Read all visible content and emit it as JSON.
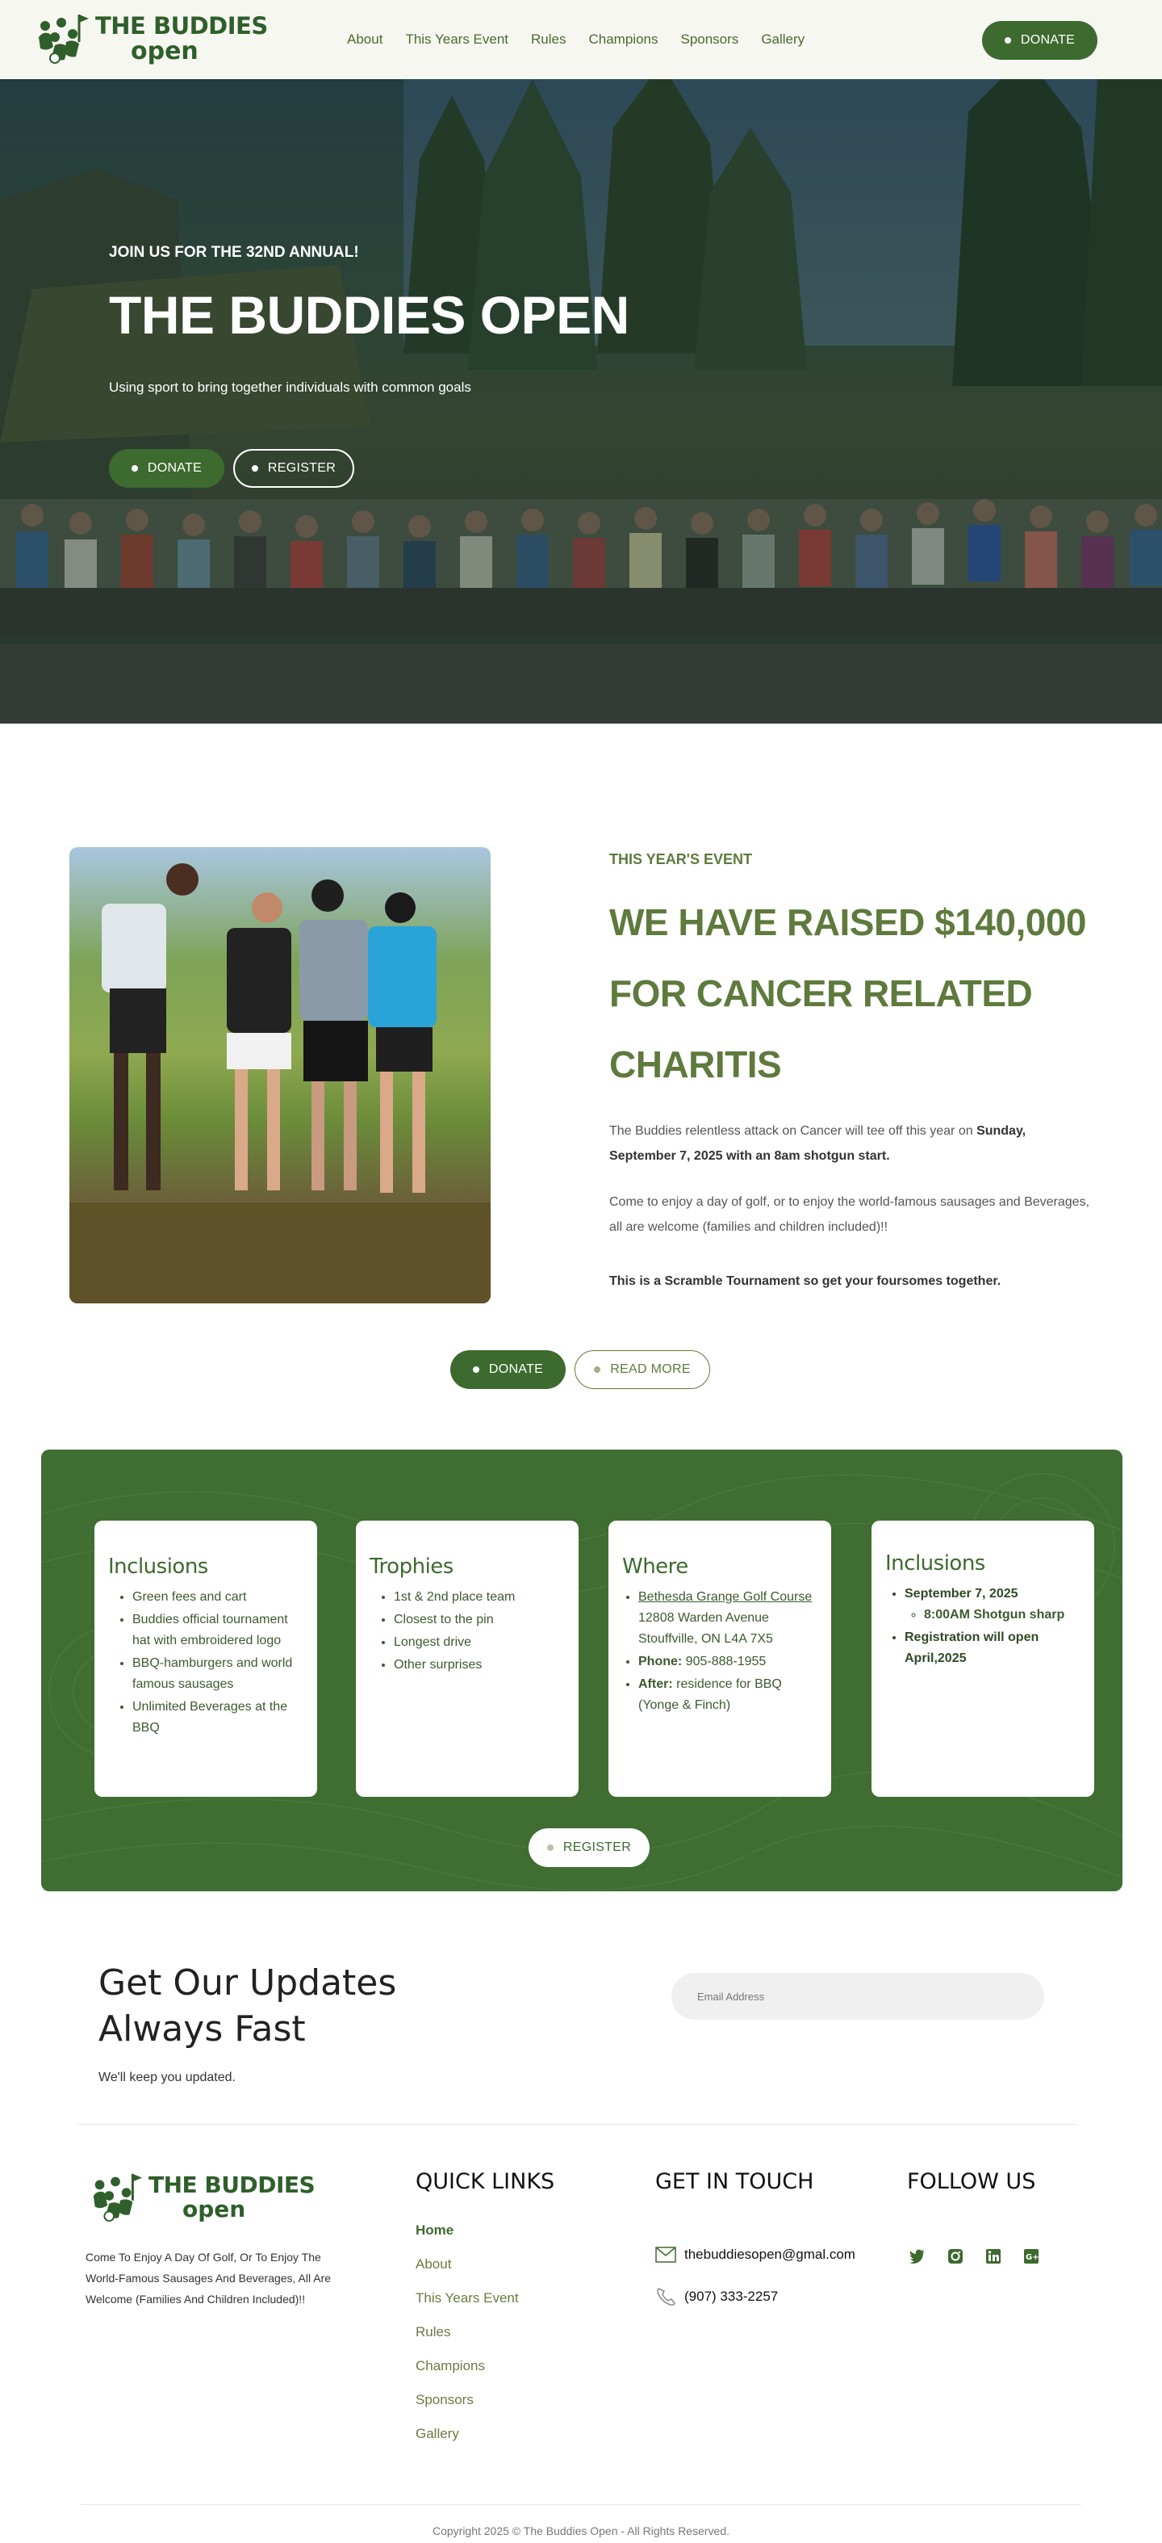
{
  "brand": {
    "line1": "THE BUDDIES",
    "line2": "open",
    "green": "#3d6a2f",
    "olive": "#5e7a3d"
  },
  "nav": {
    "items": [
      "About",
      "This Years Event",
      "Rules",
      "Champions",
      "Sponsors",
      "Gallery"
    ],
    "donate_label": "DONATE"
  },
  "hero": {
    "kicker": "JOIN US FOR THE 32ND ANNUAL!",
    "title": "THE BUDDIES OPEN",
    "subtitle": "Using sport to bring together individuals with common goals",
    "donate_label": "DONATE",
    "register_label": "REGISTER"
  },
  "event": {
    "kicker": "THIS YEAR'S EVENT",
    "title": "WE HAVE RAISED $140,000 FOR CANCER RELATED CHARITIS",
    "p1_text": "The Buddies relentless attack on Cancer will tee off this year on ",
    "p1_bold": "Sunday, September 7, 2025  with an 8am shotgun start.",
    "p2": "Come to enjoy a day of golf, or to enjoy the world-famous sausages and Beverages, all are welcome (families and children included)!!",
    "p3": "This is a Scramble Tournament so get your foursomes together.",
    "donate_label": "DONATE",
    "read_more_label": "READ MORE"
  },
  "cards": {
    "inclusions": {
      "title": "Inclusions",
      "items": [
        "Green fees and cart",
        "Buddies official tournament hat with embroidered logo",
        "BBQ-hamburgers and world famous sausages",
        "Unlimited Beverages at the BBQ"
      ]
    },
    "trophies": {
      "title": "Trophies",
      "items": [
        "1st & 2nd place team",
        "Closest to the pin",
        "Longest drive",
        "Other surprises"
      ]
    },
    "where": {
      "title": "Where",
      "venue": "Bethesda Grange Golf Course",
      "address1": "12808 Warden Avenue",
      "address2": "Stouffville, ON L4A 7X5",
      "phone_label": "Phone:",
      "phone": "905-888-1955",
      "after_label": "After:",
      "after": "residence for BBQ (Yonge & Finch)"
    },
    "dates": {
      "title": "Inclusions",
      "date": "September 7, 2025",
      "start": "8:00AM Shotgun sharp",
      "registration": "Registration will open April,2025"
    },
    "register_label": "REGISTER"
  },
  "updates": {
    "title_line1": "Get Our Updates",
    "title_line2": "Always Fast",
    "subtitle": "We'll keep you updated.",
    "email_placeholder": "Email Address"
  },
  "footer": {
    "about": "Come To Enjoy A Day Of Golf, Or To Enjoy The World-Famous Sausages And Beverages, All Are Welcome (Families And Children Included)!!",
    "quick_links_title": "QUICK LINKS",
    "quick_links": [
      "Home",
      "About",
      "This Years Event",
      "Rules",
      "Champions",
      "Sponsors",
      "Gallery"
    ],
    "contact_title": "GET IN TOUCH",
    "email": "thebuddiesopen@gmal.com",
    "phone": "(907) 333-2257",
    "follow_title": "FOLLOW US",
    "social_icons": [
      "twitter-icon",
      "instagram-icon",
      "linkedin-icon",
      "google-plus-icon"
    ],
    "copyright": "Copyright 2025 © The Buddies Open - All Rights Reserved."
  }
}
